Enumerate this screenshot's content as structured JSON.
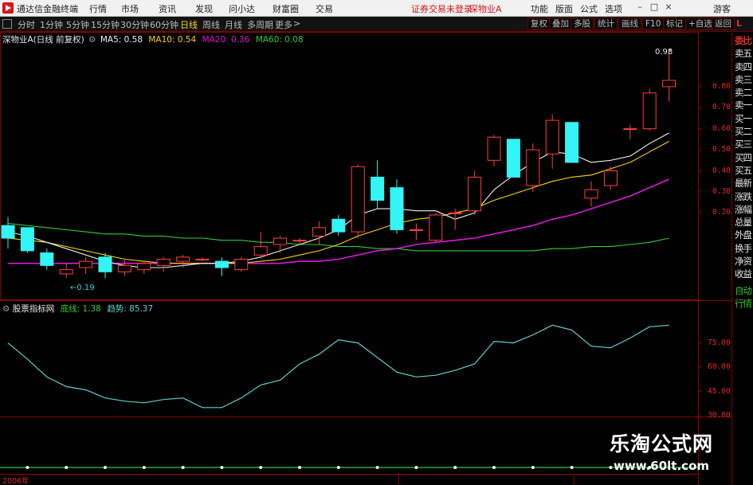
{
  "titlebar": {
    "app_title": "通达信金融终端",
    "menus": [
      "行情",
      "市场",
      "资讯",
      "发现",
      "问小达",
      "财富圈",
      "交易"
    ],
    "notice": "证券交易未登录",
    "stock_short": "深物业A",
    "right_buttons": [
      "功能",
      "版面",
      "公式",
      "选项"
    ],
    "guest": "游客",
    "colors": {
      "logo": "#d6141a",
      "notice": "#d6141a"
    }
  },
  "toolbar": {
    "tabs": [
      "分时",
      "1分钟",
      "5分钟",
      "15分钟",
      "30分钟",
      "60分钟",
      "日线",
      "周线",
      "月线",
      "多周期",
      "更多"
    ],
    "active_tab": "日线",
    "more_arrow": ">",
    "right_buttons": [
      "复权",
      "叠加",
      "多股",
      "统计",
      "画线",
      "F10",
      "标记",
      "+自选",
      "返回"
    ],
    "corner_label": "L"
  },
  "main_chart": {
    "title": "深物业A(日线 前复权)",
    "ma": [
      {
        "label": "MA5: 0.58",
        "color": "#f0f0f0"
      },
      {
        "label": "MA10: 0.54",
        "color": "#ffd200"
      },
      {
        "label": "MA20: 0.36",
        "color": "#d81bd8"
      },
      {
        "label": "MA60: 0.08",
        "color": "#33cc33"
      }
    ],
    "high_label": "0.98",
    "low_label": "0.19",
    "y_ticks": [
      "0.80",
      "0.70",
      "0.60",
      "0.50",
      "0.40",
      "0.30",
      "0.20"
    ],
    "colors": {
      "up": "#ff4040",
      "down": "#33f5f5",
      "ma5": "#f0f0f0",
      "ma10": "#ffd200",
      "ma20": "#d81bd8",
      "ma60": "#33cc33"
    },
    "candles": [
      {
        "o": 0.14,
        "h": 0.18,
        "l": 0.03,
        "c": 0.08
      },
      {
        "o": 0.13,
        "h": 0.13,
        "l": 0.01,
        "c": 0.02
      },
      {
        "o": 0.01,
        "h": 0.03,
        "l": -0.07,
        "c": -0.05
      },
      {
        "o": -0.09,
        "h": -0.04,
        "l": -0.11,
        "c": -0.07
      },
      {
        "o": -0.06,
        "h": -0.01,
        "l": -0.09,
        "c": -0.03
      },
      {
        "o": -0.01,
        "h": 0.01,
        "l": -0.11,
        "c": -0.08
      },
      {
        "o": -0.08,
        "h": -0.02,
        "l": -0.1,
        "c": -0.05
      },
      {
        "o": -0.07,
        "h": -0.03,
        "l": -0.09,
        "c": -0.04
      },
      {
        "o": -0.05,
        "h": -0.01,
        "l": -0.08,
        "c": -0.02
      },
      {
        "o": -0.03,
        "h": 0.0,
        "l": -0.06,
        "c": -0.01
      },
      {
        "o": -0.02,
        "h": -0.01,
        "l": -0.03,
        "c": -0.02
      },
      {
        "o": -0.03,
        "h": -0.01,
        "l": -0.1,
        "c": -0.06
      },
      {
        "o": -0.07,
        "h": -0.01,
        "l": -0.08,
        "c": -0.02
      },
      {
        "o": 0.0,
        "h": 0.11,
        "l": -0.02,
        "c": 0.04
      },
      {
        "o": 0.05,
        "h": 0.09,
        "l": 0.01,
        "c": 0.08
      },
      {
        "o": 0.07,
        "h": 0.08,
        "l": 0.05,
        "c": 0.07
      },
      {
        "o": 0.09,
        "h": 0.16,
        "l": 0.05,
        "c": 0.13
      },
      {
        "o": 0.17,
        "h": 0.19,
        "l": 0.09,
        "c": 0.11
      },
      {
        "o": 0.11,
        "h": 0.43,
        "l": 0.08,
        "c": 0.42
      },
      {
        "o": 0.37,
        "h": 0.45,
        "l": 0.22,
        "c": 0.26
      },
      {
        "o": 0.32,
        "h": 0.36,
        "l": 0.1,
        "c": 0.12
      },
      {
        "o": 0.12,
        "h": 0.15,
        "l": 0.07,
        "c": 0.12
      },
      {
        "o": 0.07,
        "h": 0.2,
        "l": 0.06,
        "c": 0.19
      },
      {
        "o": 0.2,
        "h": 0.22,
        "l": 0.12,
        "c": 0.2
      },
      {
        "o": 0.21,
        "h": 0.4,
        "l": 0.19,
        "c": 0.37
      },
      {
        "o": 0.45,
        "h": 0.57,
        "l": 0.42,
        "c": 0.56
      },
      {
        "o": 0.55,
        "h": 0.55,
        "l": 0.37,
        "c": 0.37
      },
      {
        "o": 0.33,
        "h": 0.53,
        "l": 0.3,
        "c": 0.5
      },
      {
        "o": 0.48,
        "h": 0.67,
        "l": 0.41,
        "c": 0.64
      },
      {
        "o": 0.63,
        "h": 0.63,
        "l": 0.44,
        "c": 0.44
      },
      {
        "o": 0.27,
        "h": 0.35,
        "l": 0.23,
        "c": 0.31
      },
      {
        "o": 0.33,
        "h": 0.42,
        "l": 0.31,
        "c": 0.4
      },
      {
        "o": 0.6,
        "h": 0.62,
        "l": 0.55,
        "c": 0.6
      },
      {
        "o": 0.6,
        "h": 0.79,
        "l": 0.59,
        "c": 0.77
      },
      {
        "o": 0.8,
        "h": 0.98,
        "l": 0.73,
        "c": 0.83
      }
    ],
    "ma_lines": {
      "ma5": [
        0.11,
        0.09,
        0.06,
        0.03,
        0.0,
        -0.03,
        -0.05,
        -0.06,
        -0.06,
        -0.05,
        -0.04,
        -0.04,
        -0.03,
        -0.01,
        0.02,
        0.05,
        0.08,
        0.12,
        0.19,
        0.22,
        0.22,
        0.21,
        0.21,
        0.17,
        0.2,
        0.31,
        0.38,
        0.44,
        0.49,
        0.48,
        0.44,
        0.45,
        0.47,
        0.53,
        0.58
      ],
      "ma10": [
        0.08,
        0.07,
        0.06,
        0.04,
        0.02,
        0.0,
        -0.02,
        -0.03,
        -0.04,
        -0.04,
        -0.04,
        -0.04,
        -0.04,
        -0.03,
        -0.02,
        0.0,
        0.02,
        0.05,
        0.09,
        0.12,
        0.15,
        0.17,
        0.18,
        0.2,
        0.22,
        0.26,
        0.29,
        0.32,
        0.35,
        0.37,
        0.38,
        0.41,
        0.44,
        0.49,
        0.54
      ],
      "ma20": [
        -0.04,
        -0.04,
        -0.04,
        -0.04,
        -0.04,
        -0.04,
        -0.04,
        -0.04,
        -0.04,
        -0.04,
        -0.04,
        -0.04,
        -0.04,
        -0.04,
        -0.04,
        -0.03,
        -0.03,
        -0.02,
        0.0,
        0.02,
        0.03,
        0.05,
        0.06,
        0.07,
        0.08,
        0.1,
        0.12,
        0.14,
        0.17,
        0.19,
        0.22,
        0.25,
        0.28,
        0.32,
        0.36
      ],
      "ma60": [
        0.15,
        0.14,
        0.13,
        0.12,
        0.11,
        0.1,
        0.1,
        0.09,
        0.09,
        0.08,
        0.08,
        0.07,
        0.07,
        0.06,
        0.06,
        0.05,
        0.05,
        0.04,
        0.04,
        0.03,
        0.03,
        0.02,
        0.02,
        0.02,
        0.02,
        0.02,
        0.02,
        0.02,
        0.03,
        0.03,
        0.04,
        0.04,
        0.05,
        0.06,
        0.08
      ]
    }
  },
  "indicator": {
    "name": "股票指标网",
    "base_label": "底线: 1.38",
    "trend_label": "趋势: 85.37",
    "y_ticks": [
      "75.00",
      "60.00",
      "45.00",
      "30.00"
    ],
    "colors": {
      "base": "#33cc33",
      "trend": "#5fd0d0",
      "dots": "#ffffff"
    },
    "trend": [
      75,
      65,
      54,
      48,
      46,
      41,
      39,
      38,
      40,
      41,
      35,
      35,
      41,
      49,
      52,
      62,
      68,
      77,
      75,
      66,
      57,
      54,
      55,
      58,
      62,
      76,
      75,
      80,
      86,
      83,
      73,
      72,
      78,
      85,
      86
    ]
  },
  "side_panel": {
    "top_label": "委比",
    "items": [
      "卖五",
      "卖四",
      "卖三",
      "卖二",
      "卖一",
      "买一",
      "买二",
      "买三",
      "买四",
      "买五",
      "最新",
      "涨跌",
      "涨幅",
      "总量",
      "外盘",
      "换手",
      "净资",
      "收益"
    ],
    "bottom_items": [
      "自动",
      "行情"
    ]
  },
  "footer": {
    "date_label": "2006年"
  },
  "watermark": {
    "line1": "乐淘公式网",
    "line2": "www.60lt.com"
  }
}
